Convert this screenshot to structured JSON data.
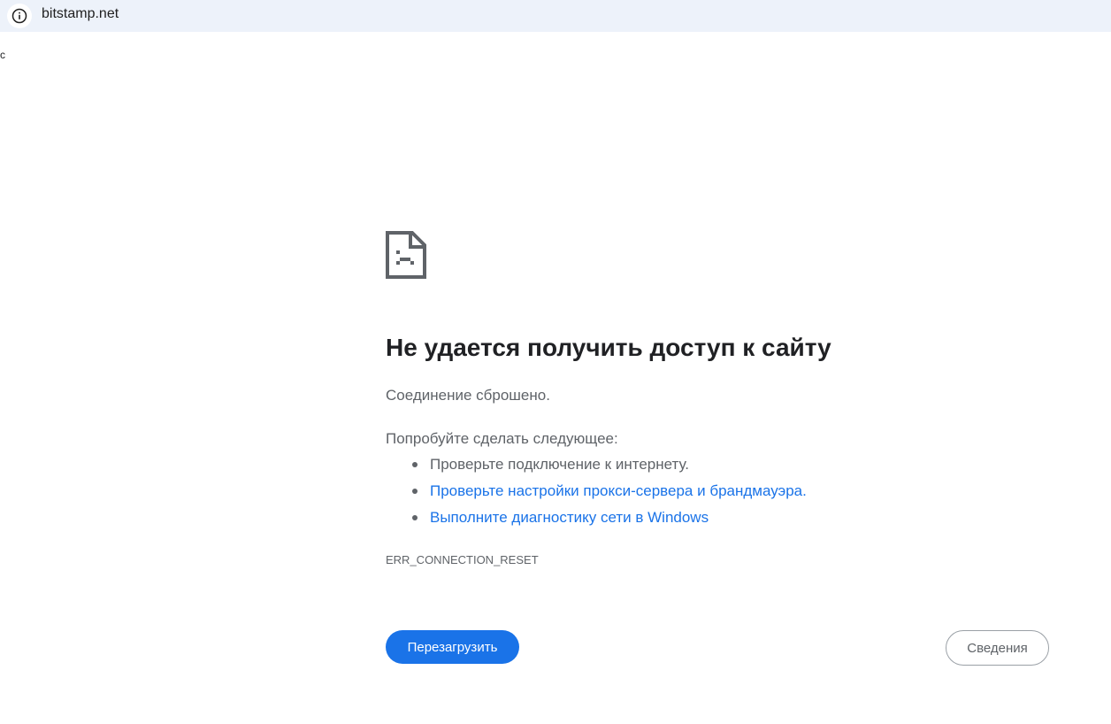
{
  "omnibox": {
    "url": "bitstamp.net",
    "info_icon": "info-icon",
    "background_color": "#edf2fa"
  },
  "stray_text": "c",
  "error_page": {
    "icon": "sad-page-icon",
    "heading": "Не удается получить доступ к сайту",
    "summary": "Соединение сброшено.",
    "suggestions_title": "Попробуйте сделать следующее:",
    "suggestions": [
      {
        "text": "Проверьте подключение к интернету.",
        "is_link": false
      },
      {
        "text": "Проверьте настройки прокси-сервера и брандмауэра.",
        "is_link": true
      },
      {
        "text": "Выполните диагностику сети в Windows",
        "is_link": true
      }
    ],
    "error_code": "ERR_CONNECTION_RESET",
    "reload_label": "Перезагрузить",
    "details_label": "Сведения"
  },
  "colors": {
    "accent": "#1a73e8",
    "text_secondary": "#5f6368",
    "heading": "#202124"
  }
}
